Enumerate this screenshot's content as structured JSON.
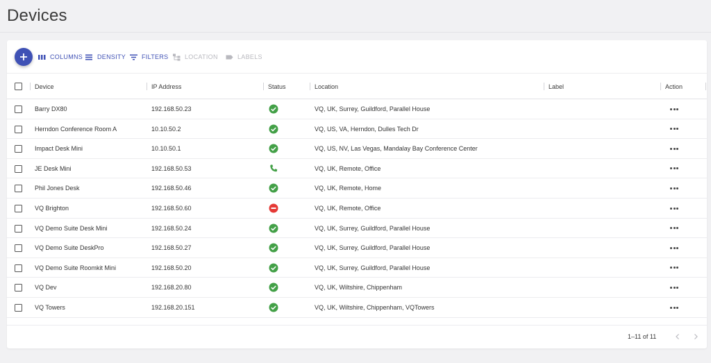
{
  "page": {
    "title": "Devices"
  },
  "toolbar": {
    "add_icon": "plus-icon",
    "columns_label": "COLUMNS",
    "density_label": "DENSITY",
    "filters_label": "FILTERS",
    "location_label": "LOCATION",
    "labels_label": "LABELS",
    "accent_color": "#3f51b5",
    "disabled_color": "#b9b9bf"
  },
  "table": {
    "columns": {
      "device": "Device",
      "ip": "IP Address",
      "status": "Status",
      "location": "Location",
      "label": "Label",
      "action": "Action"
    },
    "rows": [
      {
        "device": "Barry DX80",
        "ip": "192.168.50.23",
        "status": "online",
        "location": "VQ, UK, Surrey, Guildford, Parallel House",
        "label": ""
      },
      {
        "device": "Herndon Conference Room A",
        "ip": "10.10.50.2",
        "status": "online",
        "location": "VQ, US, VA, Herndon, Dulles Tech Dr",
        "label": ""
      },
      {
        "device": "Impact Desk Mini",
        "ip": "10.10.50.1",
        "status": "online",
        "location": "VQ, US, NV, Las Vegas, Mandalay Bay Conference Center",
        "label": ""
      },
      {
        "device": "JE Desk Mini",
        "ip": "192.168.50.53",
        "status": "in-call",
        "location": "VQ, UK, Remote, Office",
        "label": ""
      },
      {
        "device": "Phil Jones Desk",
        "ip": "192.168.50.46",
        "status": "online",
        "location": "VQ, UK, Remote, Home",
        "label": ""
      },
      {
        "device": "VQ Brighton",
        "ip": "192.168.50.60",
        "status": "offline",
        "location": "VQ, UK, Remote, Office",
        "label": ""
      },
      {
        "device": "VQ Demo Suite Desk Mini",
        "ip": "192.168.50.24",
        "status": "online",
        "location": "VQ, UK, Surrey, Guildford, Parallel House",
        "label": ""
      },
      {
        "device": "VQ Demo Suite DeskPro",
        "ip": "192.168.50.27",
        "status": "online",
        "location": "VQ, UK, Surrey, Guildford, Parallel House",
        "label": ""
      },
      {
        "device": "VQ Demo Suite Roomkit Mini",
        "ip": "192.168.50.20",
        "status": "online",
        "location": "VQ, UK, Surrey, Guildford, Parallel House",
        "label": ""
      },
      {
        "device": "VQ Dev",
        "ip": "192.168.20.80",
        "status": "online",
        "location": "VQ, UK, Wiltshire, Chippenham",
        "label": ""
      },
      {
        "device": "VQ Towers",
        "ip": "192.168.20.151",
        "status": "online",
        "location": "VQ, UK, Wiltshire, Chippenham, VQTowers",
        "label": ""
      }
    ],
    "status_colors": {
      "online": "#43a047",
      "in-call": "#43a047",
      "offline": "#e53935"
    }
  },
  "pagination": {
    "range_text": "1–11 of 11"
  }
}
